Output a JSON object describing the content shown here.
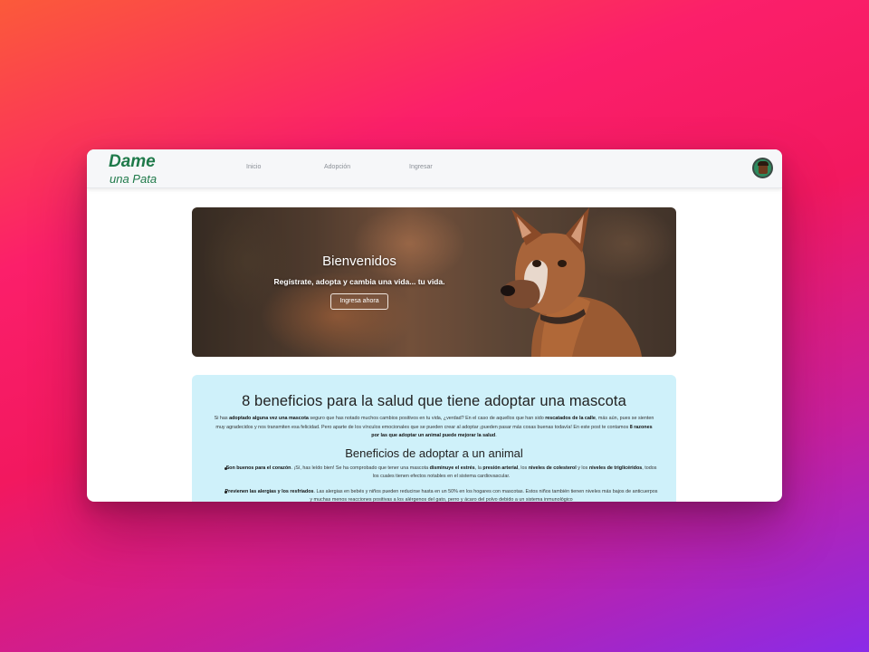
{
  "brand": {
    "line1": "Dame",
    "line2": "una Pata",
    "color": "#1f7a4a"
  },
  "nav": {
    "links": [
      "Inicio",
      "Adopción",
      "Ingresar"
    ],
    "avatar_icon": "user-avatar-icon"
  },
  "hero": {
    "title": "Bienvenidos",
    "subtitle": "Regístrate, adopta y cambia una vida... tu vida.",
    "button": "Ingresa ahora"
  },
  "article": {
    "background": "#cff1fa",
    "title": "8 beneficios para la salud que tiene adoptar una mascota",
    "intro": [
      {
        "t": "Si has "
      },
      {
        "t": "adoptado alguna vez una mascota",
        "b": true
      },
      {
        "t": " seguro que has notado muchos cambios positivos en tu vida, ¿verdad? En el caso de aquellos que han sido "
      },
      {
        "t": "rescatados de la calle",
        "b": true
      },
      {
        "t": ", más aún, pues se sienten muy agradecidos y nos transmiten esa felicidad. Pero aparte de los vínculos emocionales que se pueden crear al adoptar ¡pueden pasar más cosas buenas todavía! En este post te contamos "
      },
      {
        "t": "8 razones por las que adoptar un animal puede mejorar la salud",
        "b": true
      },
      {
        "t": "."
      }
    ],
    "subtitle": "Beneficios de adoptar a un animal",
    "benefits": [
      [
        {
          "t": "Son buenos para el corazón",
          "b": true
        },
        {
          "t": ". ¡Sí, has leído bien! Se ha comprobado que tener una mascota "
        },
        {
          "t": "disminuye el estrés",
          "b": true
        },
        {
          "t": ", la "
        },
        {
          "t": "presión arterial",
          "b": true
        },
        {
          "t": ", los "
        },
        {
          "t": "niveles de colesterol",
          "b": true
        },
        {
          "t": " y los "
        },
        {
          "t": "niveles de triglicéridos",
          "b": true
        },
        {
          "t": ", todos los cuales tienen efectos notables en el sistema cardiovascular."
        }
      ],
      [
        {
          "t": "Previenen las alergias y los resfriados",
          "b": true
        },
        {
          "t": ". Las alergias en bebés y niños pueden reducirse hasta en un 50% en los hogares con mascotas. Estos niños también tienen niveles más bajos de anticuerpos y muchas menos reacciones positivas a los alérgenos del gato, perro y ácaro del polvo debido a un sistema inmunológico"
        }
      ]
    ]
  }
}
